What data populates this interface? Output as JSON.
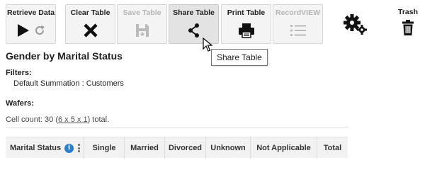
{
  "toolbar": {
    "retrieve_label": "Retrieve Data",
    "clear_label": "Clear Table",
    "save_label": "Save Table",
    "share_label": "Share Table",
    "print_label": "Print Table",
    "recordview_label": "RecordVIEW",
    "trash_label": "Trash"
  },
  "tooltip": {
    "text": "Share Table"
  },
  "report": {
    "title": "Gender by Marital Status",
    "filters_label": "Filters:",
    "filter_value": "Default Summation : Customers",
    "wafers_label": "Wafers:",
    "cellcount_prefix": "Cell count: 30 (",
    "cellcount_link": "6 x 5 x 1",
    "cellcount_suffix": ") total."
  },
  "table": {
    "row_header": "Marital Status",
    "columns": [
      "Single",
      "Married",
      "Divorced",
      "Unknown",
      "Not Applicable",
      "Total"
    ]
  },
  "colors": {
    "info_blue": "#2a7fd4",
    "disabled_grey": "#b5b5b5",
    "icon_dark": "#1a1a1a"
  }
}
